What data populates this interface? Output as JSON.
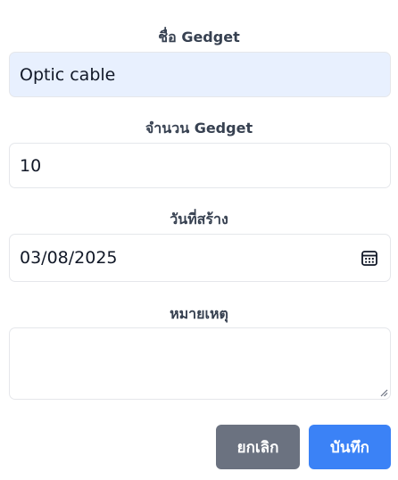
{
  "form": {
    "name_label": "ชื่อ Gedget",
    "name_value": "Optic cable",
    "quantity_label": "จำนวน Gedget",
    "quantity_value": "10",
    "date_label": "วันที่สร้าง",
    "date_value": "03/08/2025",
    "note_label": "หมายเหตุ",
    "note_value": ""
  },
  "actions": {
    "cancel_label": "ยกเลิก",
    "save_label": "บันทึก"
  },
  "colors": {
    "cancel_bg": "#6b7280",
    "save_bg": "#3b82f6",
    "autofill_bg": "#e8f0fe"
  },
  "icons": {
    "date_picker": "calendar-icon"
  }
}
